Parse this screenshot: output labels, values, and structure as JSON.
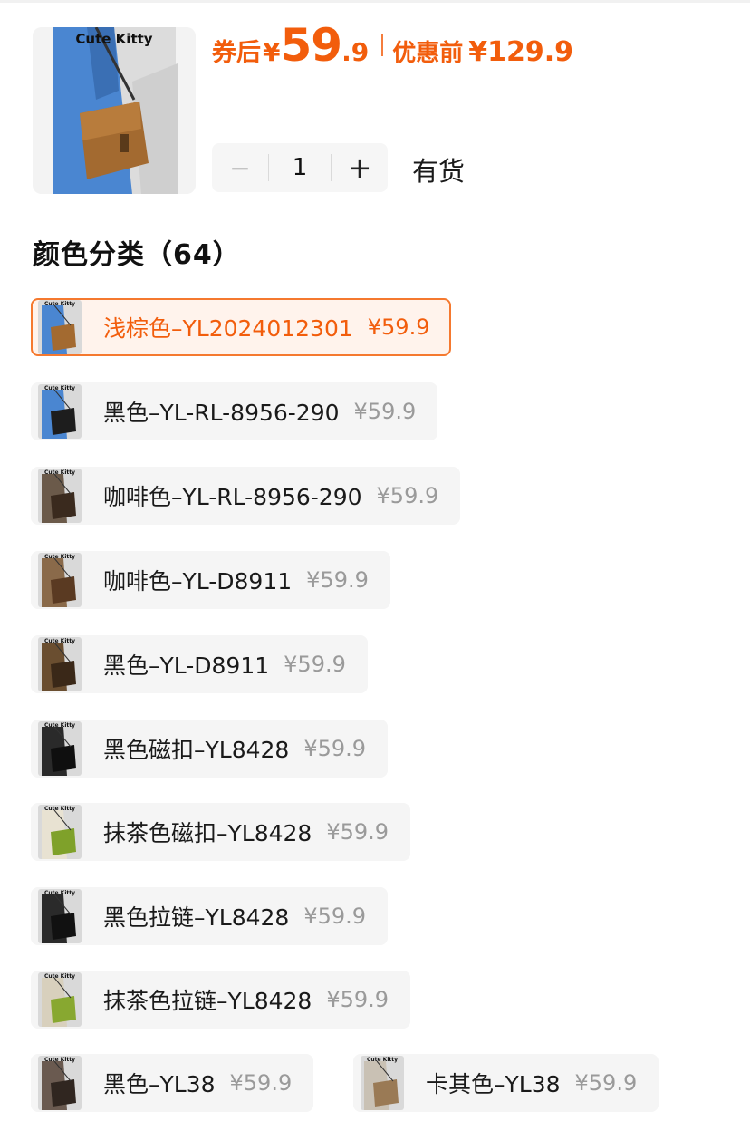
{
  "product": {
    "logo_text": "Cute Kitty",
    "price_prefix": "券后",
    "currency": "¥",
    "price_int": "59",
    "price_dec": ".9",
    "original_label": "优惠前",
    "original_price": "¥129.9",
    "accent_color": "#f25d0c"
  },
  "quantity": {
    "minus_icon": "minus-icon",
    "plus_icon": "plus-icon",
    "minus": "−",
    "plus": "+",
    "value": "1",
    "stock_status": "有货"
  },
  "section": {
    "title": "颜色分类（64）"
  },
  "skus": [
    {
      "name": "浅棕色–YL2024012301",
      "price": "¥59.9",
      "selected": true
    },
    {
      "name": "黑色–YL-RL-8956-290",
      "price": "¥59.9"
    },
    {
      "name": "咖啡色–YL-RL-8956-290",
      "price": "¥59.9"
    },
    {
      "name": "咖啡色–YL-D8911",
      "price": "¥59.9"
    },
    {
      "name": "黑色–YL-D8911",
      "price": "¥59.9"
    },
    {
      "name": "黑色磁扣–YL8428",
      "price": "¥59.9"
    },
    {
      "name": "抹茶色磁扣–YL8428",
      "price": "¥59.9"
    },
    {
      "name": "黑色拉链–YL8428",
      "price": "¥59.9"
    },
    {
      "name": "抹茶色拉链–YL8428",
      "price": "¥59.9"
    },
    {
      "name": "黑色–YL38",
      "price": "¥59.9"
    },
    {
      "name": "卡其色–YL38",
      "price": "¥59.9"
    }
  ]
}
